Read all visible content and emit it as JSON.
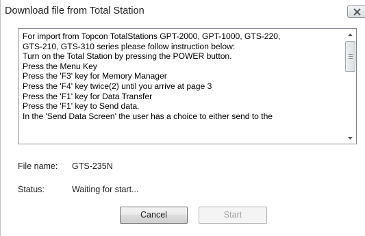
{
  "window": {
    "title": "Download file from Total Station"
  },
  "instructions": {
    "lines": [
      "For import from Topcon TotalStations GPT-2000, GPT-1000, GTS-220,",
      "GTS-210, GTS-310 series please follow instruction below:",
      "Turn on the Total Station by pressing the POWER button.",
      "Press the Menu Key",
      "Press the 'F3' key for Memory Manager",
      "Press the 'F4' key twice(2) until you arrive at page 3",
      "Press the 'F1' key for Data Transfer",
      "Press the 'F1' key to Send data.",
      "In the 'Send Data Screen' the user has a choice to either send to the"
    ]
  },
  "file": {
    "label": "File name:",
    "value": "GTS-235N"
  },
  "status": {
    "label": "Status:",
    "value": "Waiting for start..."
  },
  "buttons": {
    "cancel": "Cancel",
    "start": "Start",
    "start_enabled": false
  },
  "icons": {
    "close": "close-icon",
    "scroll_up": "chevron-up-icon",
    "scroll_down": "chevron-down-icon"
  }
}
